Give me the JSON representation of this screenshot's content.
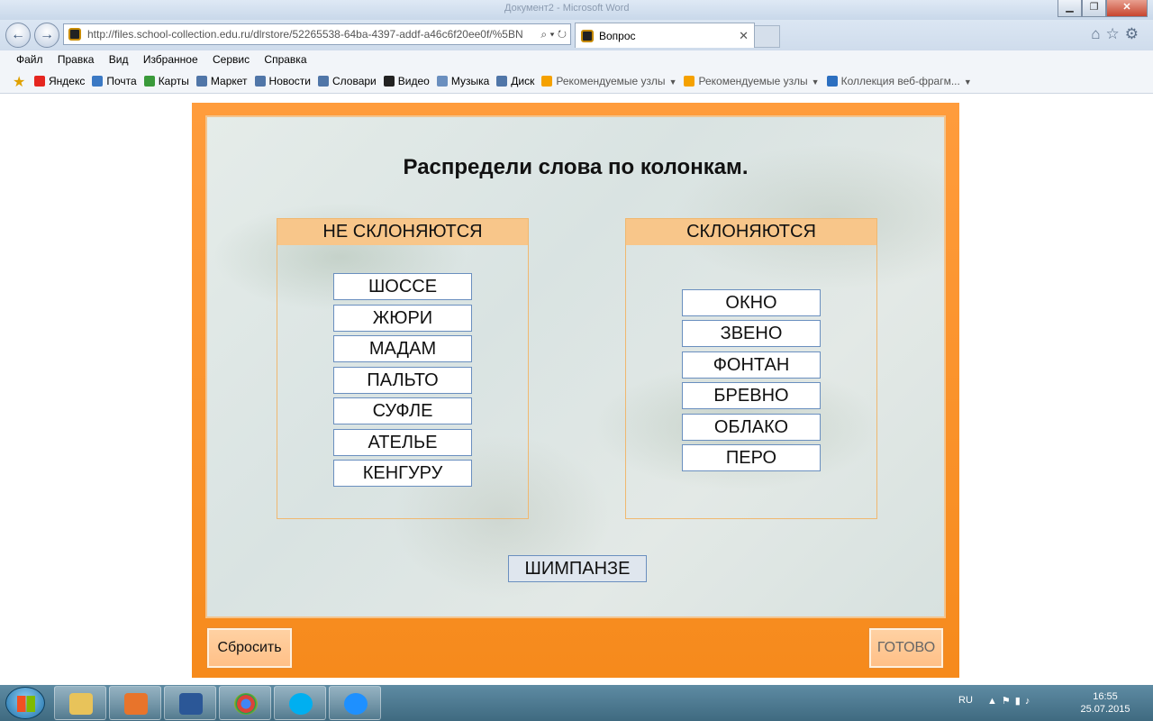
{
  "browser": {
    "ghost_title": "Документ2 - Microsoft Word",
    "url": "http://files.school-collection.edu.ru/dlrstore/52265538-64ba-4397-addf-a46c6f20ee0f/%5BN",
    "tab_title": "Вопрос",
    "menu": [
      "Файл",
      "Правка",
      "Вид",
      "Избранное",
      "Сервис",
      "Справка"
    ],
    "favorites": [
      {
        "label": "Яндекс",
        "icon": "yandex-icon",
        "color": "#e52620"
      },
      {
        "label": "Почта",
        "icon": "mail-icon",
        "color": "#3b79c4"
      },
      {
        "label": "Карты",
        "icon": "maps-icon",
        "color": "#3a9a3a"
      },
      {
        "label": "Маркет",
        "icon": "market-icon",
        "color": "#5076a8"
      },
      {
        "label": "Новости",
        "icon": "news-icon",
        "color": "#5076a8"
      },
      {
        "label": "Словари",
        "icon": "dictionary-icon",
        "color": "#5076a8"
      },
      {
        "label": "Видео",
        "icon": "video-icon",
        "color": "#222222"
      },
      {
        "label": "Музыка",
        "icon": "music-icon",
        "color": "#6a8fbf"
      },
      {
        "label": "Диск",
        "icon": "disk-icon",
        "color": "#5076a8"
      },
      {
        "label": "Рекомендуемые узлы",
        "icon": "suggested-sites-icon",
        "color": "#f5a100",
        "dropdown": true
      },
      {
        "label": "Рекомендуемые узлы",
        "icon": "suggested-sites-icon",
        "color": "#f5a100",
        "dropdown": true
      },
      {
        "label": "Коллекция веб-фрагм...",
        "icon": "web-slice-icon",
        "color": "#2c6fc0",
        "dropdown": true
      }
    ]
  },
  "task": {
    "title": "Распредели слова по колонкам.",
    "left_column": {
      "header": "НЕ СКЛОНЯЮТСЯ",
      "words": [
        "ШОССЕ",
        "ЖЮРИ",
        "МАДАМ",
        "ПАЛЬТО",
        "СУФЛЕ",
        "АТЕЛЬЕ",
        "КЕНГУРУ"
      ]
    },
    "right_column": {
      "header": "СКЛОНЯЮТСЯ",
      "words": [
        "ОКНО",
        "ЗВЕНО",
        "ФОНТАН",
        "БРЕВНО",
        "ОБЛАКО",
        "ПЕРО"
      ]
    },
    "pool_words": [
      "ШИМПАНЗЕ"
    ],
    "reset_label": "Сбросить",
    "done_label": "ГОТОВО"
  },
  "taskbar": {
    "apps": [
      "explorer",
      "media-player",
      "word",
      "chrome",
      "skype",
      "internet-explorer"
    ],
    "language": "RU",
    "time": "16:55",
    "date": "25.07.2015"
  },
  "colors": {
    "frame_orange": "#f68a1c",
    "header_orange": "#f8c68a",
    "word_border": "#6a8fbf"
  }
}
